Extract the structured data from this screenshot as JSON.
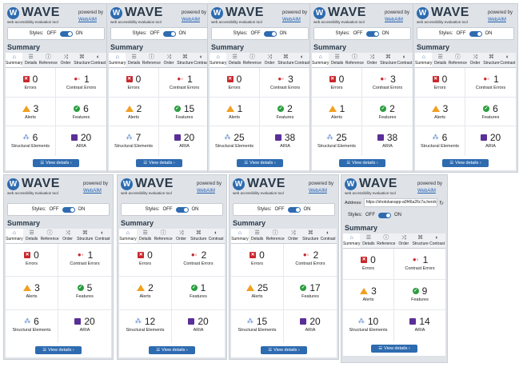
{
  "app": {
    "name": "WAVE",
    "tagline": "web accessibility evaluation tool",
    "powered_by": "powered by",
    "powered_link": "WebAIM",
    "styles_label": "Styles:",
    "off": "OFF",
    "on": "ON",
    "summary": "Summary",
    "tabs": [
      "Summary",
      "Details",
      "Reference",
      "Order",
      "Structure",
      "Contrast"
    ],
    "labels": {
      "errors": "Errors",
      "contrast": "Contrast Errors",
      "alerts": "Alerts",
      "features": "Features",
      "structure": "Structural Elements",
      "aria": "ARIA"
    },
    "view_details": "View details ›",
    "address_label": "Address:",
    "address_value": "https://shotokanapp-a0f46a26c7a.heroku"
  },
  "colors": {
    "accent": "#2e6bb0",
    "error": "#c8282c",
    "alert": "#f0a020",
    "feature": "#2a9d3f",
    "aria": "#5a2f98"
  },
  "icons": [
    "summary-home-icon",
    "details-list-icon",
    "reference-info-icon",
    "order-shuffle-icon",
    "structure-tree-icon",
    "contrast-icon"
  ],
  "panels": [
    {
      "errors": "0",
      "contrast": "1",
      "alerts": "3",
      "features": "6",
      "structure": "6",
      "aria": "20"
    },
    {
      "errors": "0",
      "contrast": "1",
      "alerts": "2",
      "features": "15",
      "structure": "7",
      "aria": "20"
    },
    {
      "errors": "0",
      "contrast": "3",
      "alerts": "1",
      "features": "2",
      "structure": "25",
      "aria": "38"
    },
    {
      "errors": "0",
      "contrast": "3",
      "alerts": "1",
      "features": "2",
      "structure": "25",
      "aria": "38"
    },
    {
      "errors": "0",
      "contrast": "1",
      "alerts": "3",
      "features": "6",
      "structure": "6",
      "aria": "20"
    },
    {
      "errors": "0",
      "contrast": "1",
      "alerts": "3",
      "features": "5",
      "structure": "6",
      "aria": "20"
    },
    {
      "errors": "0",
      "contrast": "2",
      "alerts": "2",
      "features": "1",
      "structure": "12",
      "aria": "20"
    },
    {
      "errors": "0",
      "contrast": "2",
      "alerts": "25",
      "features": "17",
      "structure": "15",
      "aria": "20"
    },
    {
      "errors": "0",
      "contrast": "1",
      "alerts": "3",
      "features": "9",
      "structure": "10",
      "aria": "14"
    }
  ]
}
